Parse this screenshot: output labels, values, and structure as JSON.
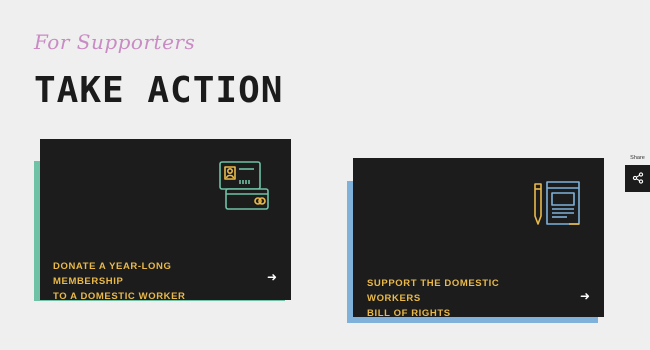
{
  "header": {
    "eyebrow": "For Supporters",
    "title": "TAKE ACTION"
  },
  "cards": [
    {
      "line1": "DONATE A YEAR-LONG MEMBERSHIP",
      "line2": "TO A DOMESTIC WORKER",
      "arrow": "➜",
      "icon": "credit-cards-icon",
      "accent_color": "#6fc2a6"
    },
    {
      "line1": "SUPPORT THE DOMESTIC WORKERS",
      "line2": "BILL OF RIGHTS",
      "arrow": "➜",
      "icon": "pen-document-icon",
      "accent_color": "#7fb1db"
    }
  ],
  "share": {
    "label": "Share",
    "icon": "share-icon"
  },
  "colors": {
    "card_bg": "#1c1c1c",
    "card_text": "#e9b949",
    "eyebrow": "#c98bc4",
    "title": "#1b1b1b",
    "background": "#efefef"
  }
}
